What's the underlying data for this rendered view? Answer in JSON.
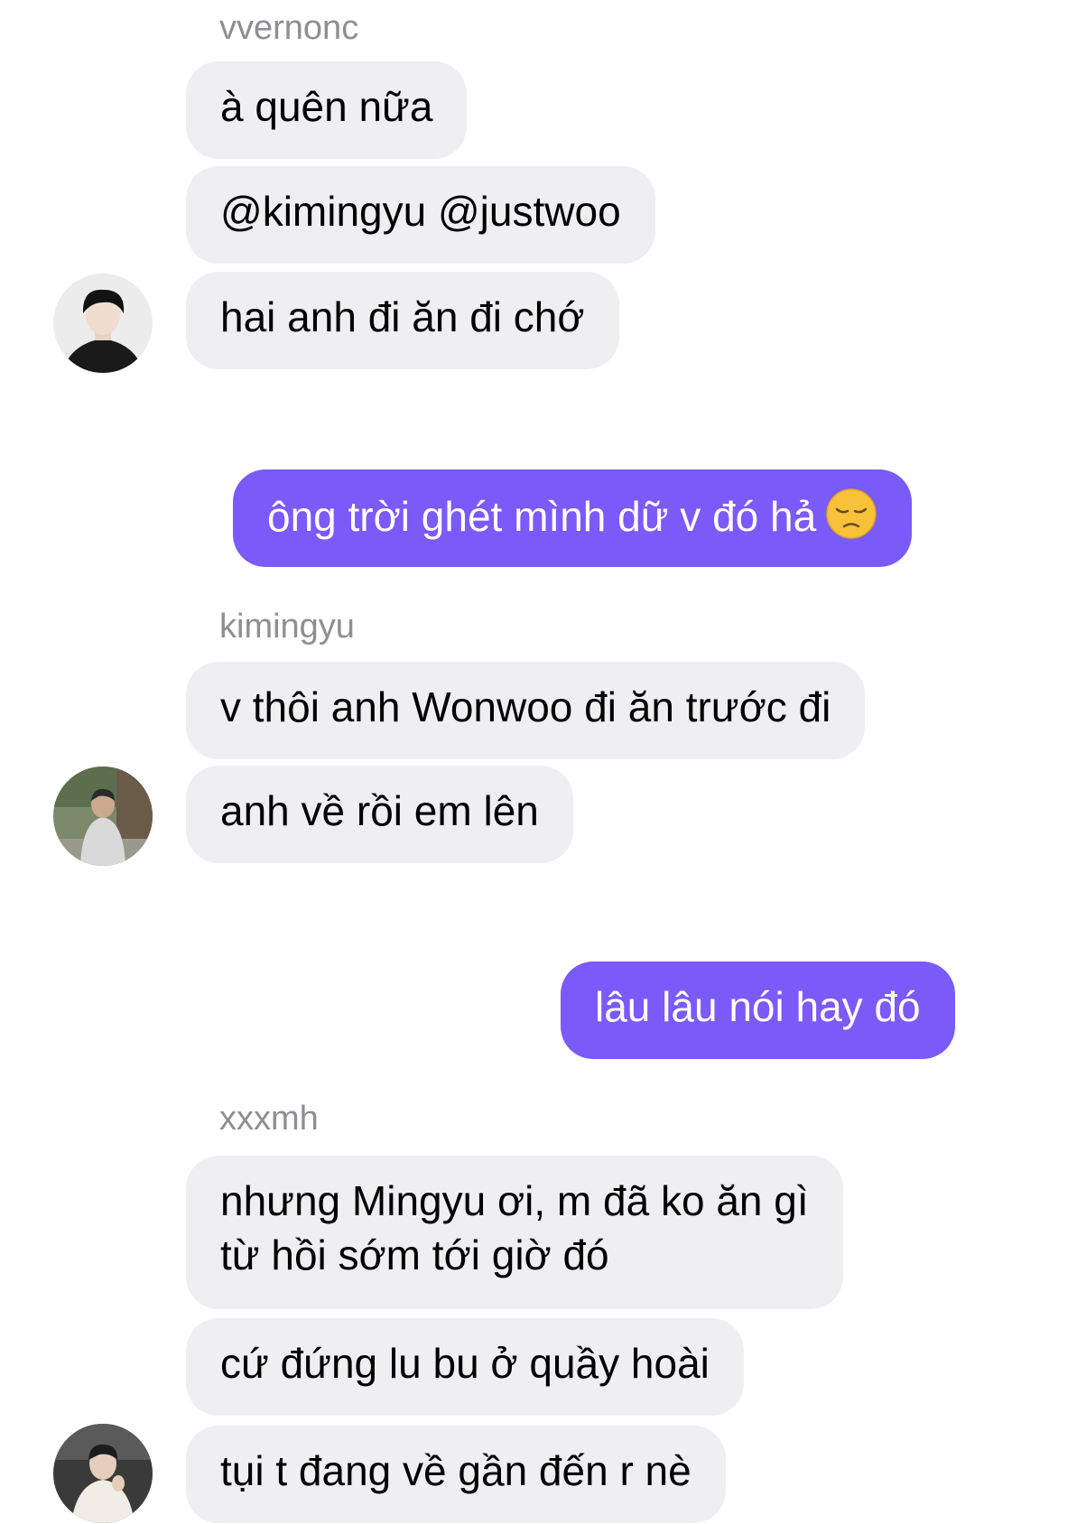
{
  "chat": {
    "groups": [
      {
        "sender": "vvernonc",
        "avatar_icon": "user-avatar-dark-hair",
        "messages": [
          "à quên nữa",
          "@kimingyu @justwoo",
          "hai anh đi ăn đi chớ"
        ]
      },
      {
        "outgoing": "ông trời ghét mình dữ v đó hả",
        "emoji_icon": "pensive-face-emoji"
      },
      {
        "sender": "kimingyu",
        "avatar_icon": "user-avatar-outdoor-hoodie",
        "messages": [
          "v thôi anh Wonwoo đi ăn trước đi",
          "anh về rồi em lên"
        ]
      },
      {
        "outgoing": "lâu lâu nói hay đó"
      },
      {
        "sender": "xxxmh",
        "avatar_icon": "user-avatar-white-sweater",
        "messages": [
          "nhưng Mingyu ơi, m đã ko ăn gì\ntừ hồi sớm tới giờ đó",
          "cứ đứng lu bu ở quầy hoài",
          "tụi t đang về gần đến r nè"
        ]
      }
    ]
  },
  "colors": {
    "outgoing_bubble": "#7a5af8",
    "incoming_bubble": "#efeff1",
    "sender_name": "#8e8e93"
  }
}
